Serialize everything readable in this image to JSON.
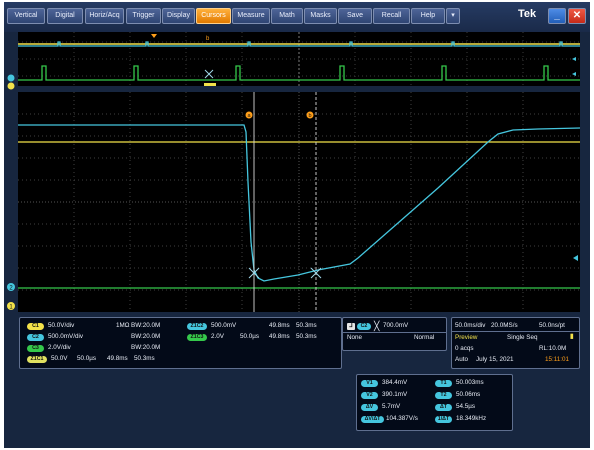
{
  "menu": {
    "items": [
      "Vertical",
      "Digital",
      "Horiz/Acq",
      "Trigger",
      "Display",
      "Cursors",
      "Measure",
      "Math",
      "Masks",
      "Save",
      "Recall",
      "Help"
    ],
    "active": "Cursors",
    "dropdown_icon": "chevron-down-icon",
    "brand": "Tek",
    "minimize_icon": "minimize-icon",
    "close_icon": "close-icon"
  },
  "colors": {
    "ch1": "#f3e24a",
    "ch2": "#45c6de",
    "ch3": "#35c84b",
    "math": "#e0e060",
    "menu_active": "#f29a1d",
    "grid": "#404040"
  },
  "cursor_markers": {
    "a": "a",
    "b": "b"
  },
  "channels": [
    {
      "tag": "C1",
      "scale": "50.0V/div",
      "coupling": "1MΩ",
      "bw": "BW:20.0M"
    },
    {
      "tag": "C2",
      "scale": "500.0mV/div",
      "coupling": "",
      "bw": "BW:20.0M"
    },
    {
      "tag": "C3",
      "scale": "2.0V/div",
      "coupling": "",
      "bw": "BW:20.0M"
    },
    {
      "tag": "Z1C1",
      "scale": "50.0V",
      "t1": "50.0µs",
      "t2": "49.8ms",
      "t3": "50.3ms"
    }
  ],
  "zoom_channels": [
    {
      "tag": "Z1C2",
      "scale": "500.0mV",
      "t2": "49.8ms",
      "t3": "50.3ms"
    },
    {
      "tag": "Z1C3",
      "scale": "2.0V",
      "t1": "50.0µs",
      "t2": "49.8ms",
      "t3": "50.3ms"
    }
  ],
  "trigger": {
    "icon": "trigger-edge-icon",
    "source": "C2",
    "slope": "╳",
    "level": "700.0mV",
    "mode_left": "None",
    "mode_right": "Normal"
  },
  "acquisition": {
    "timebase": "50.0ms/div",
    "sample_rate": "20.0MS/s",
    "resolution": "50.0ns/pt",
    "status": "Preview",
    "mode": "Single Seq",
    "acqs": "0 acqs",
    "record_length": "RL:10.0M",
    "trigger_mode": "Auto",
    "date": "July 15, 2021",
    "time": "15:11:01"
  },
  "cursor_readouts": {
    "left": [
      {
        "tag": "V1",
        "value": "384.4mV"
      },
      {
        "tag": "V2",
        "value": "390.1mV"
      },
      {
        "tag": "ΔV",
        "value": "5.7mV"
      },
      {
        "tag": "ΔV/ΔT",
        "value": "104.387V/s"
      }
    ],
    "right": [
      {
        "tag": "T1",
        "value": "50.003ms"
      },
      {
        "tag": "T2",
        "value": "50.06ms"
      },
      {
        "tag": "ΔT",
        "value": "54.5µs"
      },
      {
        "tag": "1/ΔT",
        "value": "18.349kHz"
      }
    ]
  },
  "ground_markers": {
    "ch2": "2",
    "ch1": "1"
  }
}
